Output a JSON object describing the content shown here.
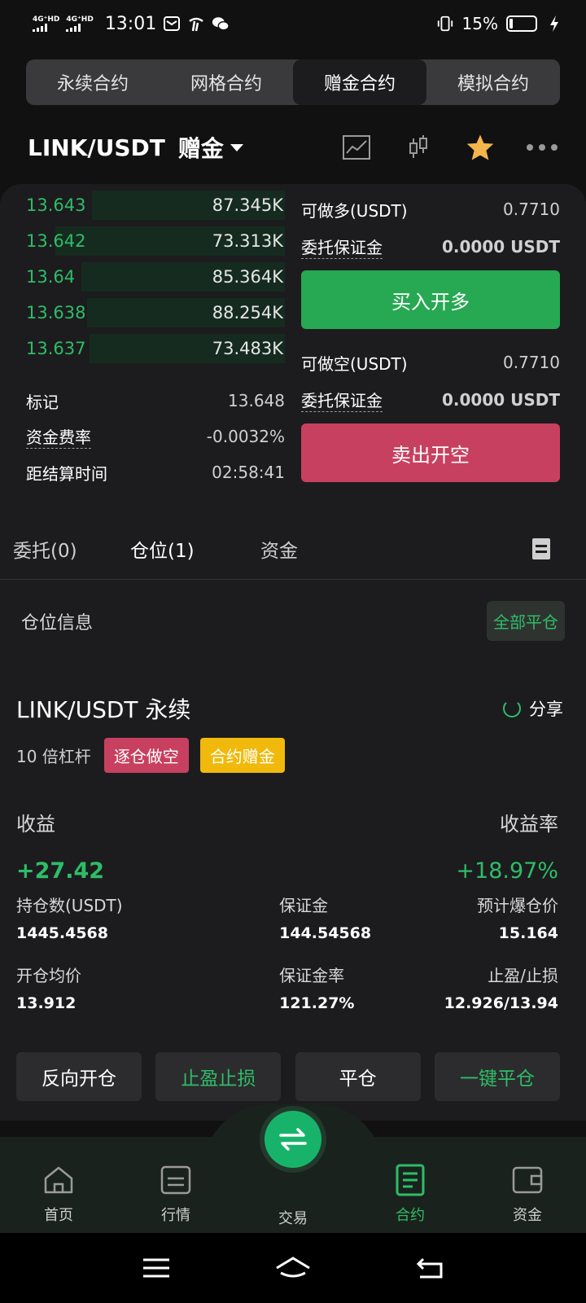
{
  "status": {
    "net1": "4G⁺HD",
    "net2": "4G⁺HD",
    "time": "13:01",
    "battery": "15%"
  },
  "segments": [
    "永续合约",
    "网格合约",
    "赠金合约",
    "模拟合约"
  ],
  "pair": {
    "name": "LINK/USDT",
    "mode": "赠金"
  },
  "orderbook": [
    {
      "price": "13.643",
      "qty": "87.345K",
      "depth": 0.74
    },
    {
      "price": "13.642",
      "qty": "73.313K",
      "depth": 0.88
    },
    {
      "price": "13.64",
      "qty": "85.364K",
      "depth": 0.78
    },
    {
      "price": "13.638",
      "qty": "88.254K",
      "depth": 0.76
    },
    {
      "price": "13.637",
      "qty": "73.483K",
      "depth": 0.75
    }
  ],
  "market_info": {
    "mark_label": "标记",
    "mark_value": "13.648",
    "funding_label": "资金费率",
    "funding_value": "-0.0032%",
    "settle_label": "距结算时间",
    "settle_value": "02:58:41"
  },
  "trade": {
    "long_avail_label": "可做多(USDT)",
    "long_avail_value": "0.7710",
    "long_margin_label": "委托保证金",
    "long_margin_value": "0.0000 USDT",
    "buy_label": "买入开多",
    "short_avail_label": "可做空(USDT)",
    "short_avail_value": "0.7710",
    "short_margin_label": "委托保证金",
    "short_margin_value": "0.0000 USDT",
    "sell_label": "卖出开空"
  },
  "tabs": [
    "委托(0)",
    "仓位(1)",
    "资金"
  ],
  "position": {
    "header": "仓位信息",
    "close_all": "全部平仓",
    "name": "LINK/USDT 永续",
    "share": "分享",
    "leverage": "10 倍杠杆",
    "tag_short": "逐仓做空",
    "tag_bonus": "合约赠金",
    "pnl_label": "收益",
    "pnl_rate_label": "收益率",
    "pnl_value": "+27.42",
    "pnl_rate_value": "+18.97%",
    "size_label": "持仓数(USDT)",
    "size_value": "1445.4568",
    "margin_label": "保证金",
    "margin_value": "144.54568",
    "liq_label": "预计爆仓价",
    "liq_value": "15.164",
    "entry_label": "开仓均价",
    "entry_value": "13.912",
    "margin_rate_label": "保证金率",
    "margin_rate_value": "121.27%",
    "tpsl_label": "止盈/止损",
    "tpsl_value": "12.926/13.94",
    "actions": [
      "反向开仓",
      "止盈止损",
      "平仓",
      "一键平仓"
    ]
  },
  "nav": [
    "首页",
    "行情",
    "交易",
    "合约",
    "资金"
  ],
  "colors": {
    "green": "#2ebd67",
    "red": "#c8405f",
    "yellow": "#f0b90b",
    "accent": "#18b36a"
  }
}
